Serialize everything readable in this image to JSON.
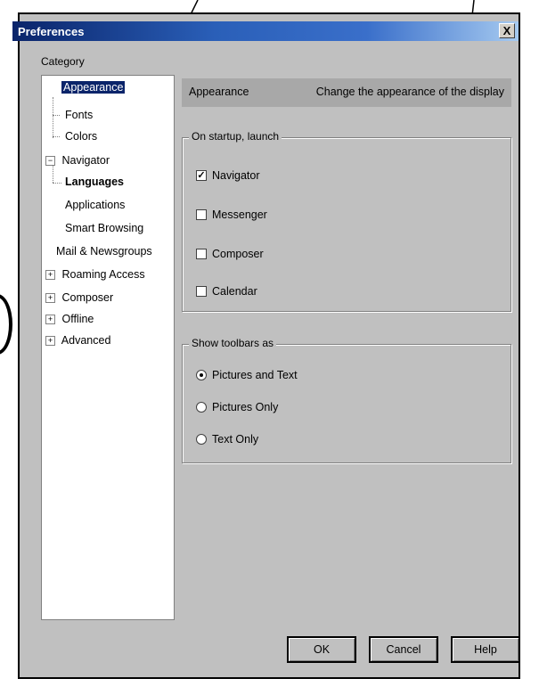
{
  "window": {
    "title": "Preferences",
    "close_glyph": "X"
  },
  "sidebar": {
    "category_label": "Category",
    "items": [
      {
        "label": "Appearance",
        "expander": "",
        "selected": true
      },
      {
        "label": "Fonts",
        "expander": ""
      },
      {
        "label": "Colors",
        "expander": ""
      },
      {
        "label": "Navigator",
        "expander": "−"
      },
      {
        "label": "Languages",
        "expander": ""
      },
      {
        "label": "Applications",
        "expander": ""
      },
      {
        "label": "Smart Browsing",
        "expander": ""
      },
      {
        "label": "Mail & Newsgroups",
        "expander": ""
      },
      {
        "label": "Roaming Access",
        "expander": "+"
      },
      {
        "label": "Composer",
        "expander": "+"
      },
      {
        "label": "Offline",
        "expander": "+"
      },
      {
        "label": "Advanced",
        "expander": "+"
      }
    ]
  },
  "panel": {
    "header_title": "Appearance",
    "header_desc": "Change the appearance of the display",
    "startup_group": {
      "legend": "On startup, launch",
      "options": [
        {
          "label": "Navigator",
          "checked": true
        },
        {
          "label": "Messenger",
          "checked": false
        },
        {
          "label": "Composer",
          "checked": false
        },
        {
          "label": "Calendar",
          "checked": false
        }
      ]
    },
    "toolbars_group": {
      "legend": "Show toolbars as",
      "options": [
        {
          "label": "Pictures and Text",
          "selected": true
        },
        {
          "label": "Pictures Only",
          "selected": false
        },
        {
          "label": "Text Only",
          "selected": false
        }
      ]
    }
  },
  "footer": {
    "ok_label": "OK",
    "cancel_label": "Cancel",
    "help_label": "Help"
  },
  "colors": {
    "title_bar": "#0a246a",
    "dialog_bg": "#c0c0c0",
    "selection": "#0a246a"
  }
}
